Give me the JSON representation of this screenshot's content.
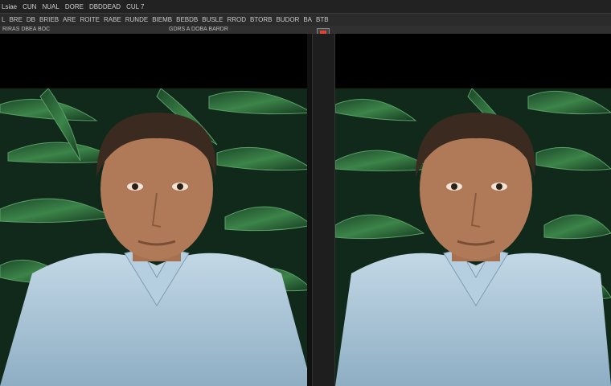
{
  "titlebar": {
    "items": [
      "Lsiae",
      "CUN",
      "NUAL",
      "DORE",
      "DBDDEAD",
      "CUL 7"
    ]
  },
  "menubar": {
    "items": [
      "L",
      "BRE",
      "DB",
      "BRIEB",
      "ARE",
      "ROITE",
      "RABE",
      "RUNDE",
      "BIEMB",
      "BEBDB",
      "BUSLE",
      "RROD",
      "BTORB",
      "BUDOR",
      "BA",
      "BTB"
    ]
  },
  "options": {
    "left": "RIRAS DBEA BOC",
    "mid": "GDRS A DOBA BARDR"
  },
  "photo": {
    "description_icon": "portrait-photo"
  },
  "colors": {
    "foliage": "#2d6a3a",
    "shirt": "#a9c4d6",
    "skin": "#b07a58",
    "hair": "#3b2a20"
  }
}
